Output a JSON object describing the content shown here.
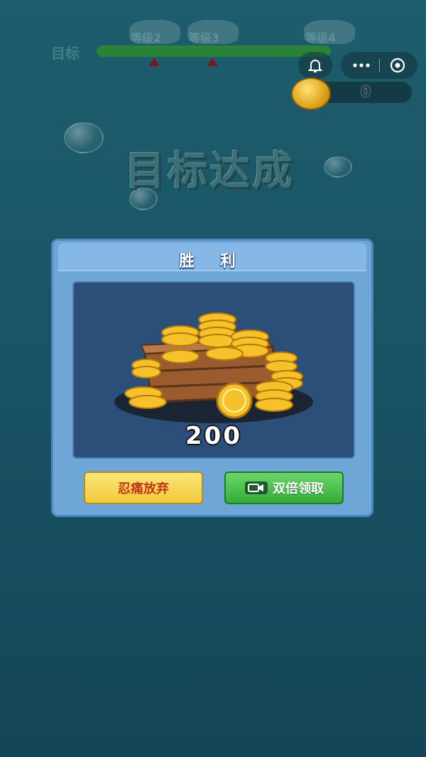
{
  "hud": {
    "goal_label": "目标",
    "levels": [
      {
        "label": "等级2"
      },
      {
        "label": "等级3"
      },
      {
        "label": "等级4"
      }
    ],
    "coin_count": "0"
  },
  "banner": {
    "title": "目标达成"
  },
  "dialog": {
    "title": "胜 利",
    "reward_amount": "200",
    "give_up_label": "忍痛放弃",
    "double_claim_label": "双倍领取"
  },
  "colors": {
    "progress_green": "#2d8a2f",
    "panel_blue": "#6ea6d8",
    "reward_bg": "#2c4f7a",
    "give_up_yellow": "#f0c93a",
    "double_green": "#32ad3a"
  }
}
